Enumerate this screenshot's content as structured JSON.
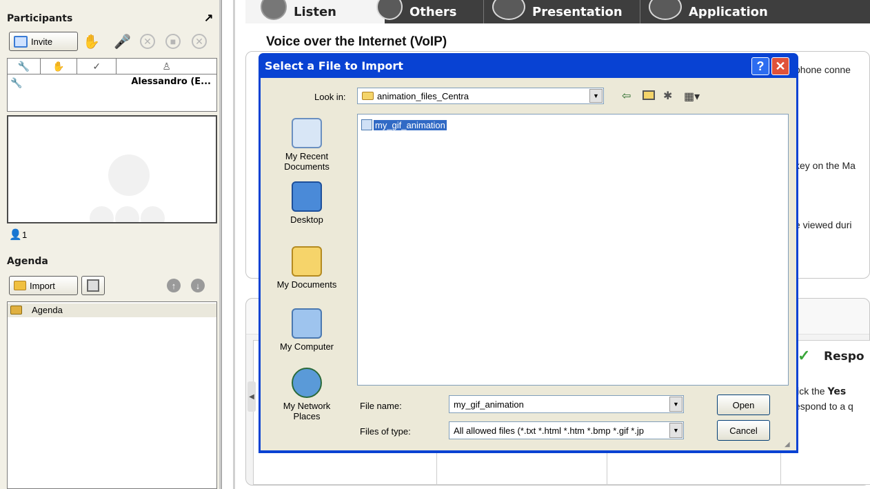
{
  "participants": {
    "title": "Participants",
    "popout_icon": "arrow-up-right-icon",
    "invite_label": "Invite",
    "user_name": "Alessandro (E...",
    "count": "1"
  },
  "agenda": {
    "title": "Agenda",
    "import_label": "Import",
    "root_item": "Agenda"
  },
  "tabs": [
    "Listen",
    "Others",
    "Presentation",
    "Application"
  ],
  "main": {
    "voip_title": "Voice over the Internet (VoIP)",
    "fragment_1": "phone conne",
    "fragment_2": "key on the Ma",
    "fragment_3": "e viewed duri",
    "respond_heading": "Respo",
    "fragment_4_prefix": "lick the ",
    "fragment_4_bold": "Yes",
    "fragment_5": "espond to a q"
  },
  "dialog": {
    "title": "Select a File to Import",
    "help_glyph": "?",
    "close_glyph": "✕",
    "look_in_label": "Look in:",
    "look_in_value": "animation_files_Centra",
    "places": [
      {
        "label": "My Recent Documents",
        "icon": "recent-documents-icon"
      },
      {
        "label": "Desktop",
        "icon": "desktop-icon"
      },
      {
        "label": "My Documents",
        "icon": "my-documents-icon"
      },
      {
        "label": "My Computer",
        "icon": "my-computer-icon"
      },
      {
        "label": "My Network Places",
        "icon": "network-places-icon"
      }
    ],
    "files": [
      "my_gif_animation"
    ],
    "file_name_label": "File name:",
    "file_name_value": "my_gif_animation",
    "files_of_type_label": "Files of type:",
    "files_of_type_value": "All allowed files (*.txt *.html *.htm *.bmp *.gif *.jp",
    "open_label": "Open",
    "cancel_label": "Cancel"
  },
  "colors": {
    "dialog_title_bar": "#0842d3",
    "dialog_body": "#ece9d8",
    "selection": "#316ac5",
    "tab_bar": "#3e3e3e",
    "left_panel": "#f2f0e6"
  }
}
